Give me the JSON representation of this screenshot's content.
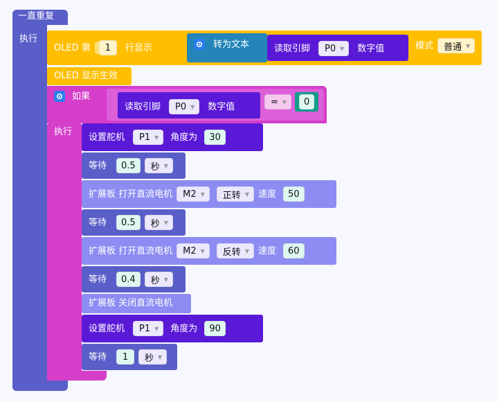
{
  "forever": {
    "label": "一直重复",
    "do_label": "执行"
  },
  "oled_show": {
    "prefix": "OLED 第",
    "row": "1",
    "suffix": "行显示",
    "to_text": "转为文本",
    "read_pin": "读取引脚",
    "pin": "P0",
    "digital": "数字值",
    "mode_label": "模式",
    "mode": "普通"
  },
  "oled_apply": {
    "label": "OLED 显示生效"
  },
  "if_block": {
    "label": "如果",
    "do_label": "执行",
    "read_pin": "读取引脚",
    "pin": "P0",
    "digital": "数字值",
    "op": "=",
    "value": "0"
  },
  "inner": [
    {
      "type": "servo",
      "label": "设置舵机",
      "pin": "P1",
      "angle_label": "角度为",
      "angle": "30"
    },
    {
      "type": "wait",
      "label": "等待",
      "value": "0.5",
      "unit": "秒"
    },
    {
      "type": "motor",
      "label": "扩展板 打开直流电机",
      "motor": "M2",
      "dir": "正转",
      "speed_label": "速度",
      "speed": "50"
    },
    {
      "type": "wait",
      "label": "等待",
      "value": "0.5",
      "unit": "秒"
    },
    {
      "type": "motor",
      "label": "扩展板 打开直流电机",
      "motor": "M2",
      "dir": "反转",
      "speed_label": "速度",
      "speed": "60"
    },
    {
      "type": "wait",
      "label": "等待",
      "value": "0.4",
      "unit": "秒"
    },
    {
      "type": "stop",
      "label": "扩展板 关闭直流电机"
    },
    {
      "type": "servo",
      "label": "设置舵机",
      "pin": "P1",
      "angle_label": "角度为",
      "angle": "90"
    },
    {
      "type": "wait",
      "label": "等待",
      "value": "1",
      "unit": "秒"
    }
  ],
  "colors": {
    "forever": "#5a5ec8",
    "oled": "#ffbf00",
    "teal": "#2385b8",
    "io": "#5a19d6",
    "if": "#d53ec9",
    "wait": "#5a5ec8",
    "ext": "#8c8cf2"
  }
}
